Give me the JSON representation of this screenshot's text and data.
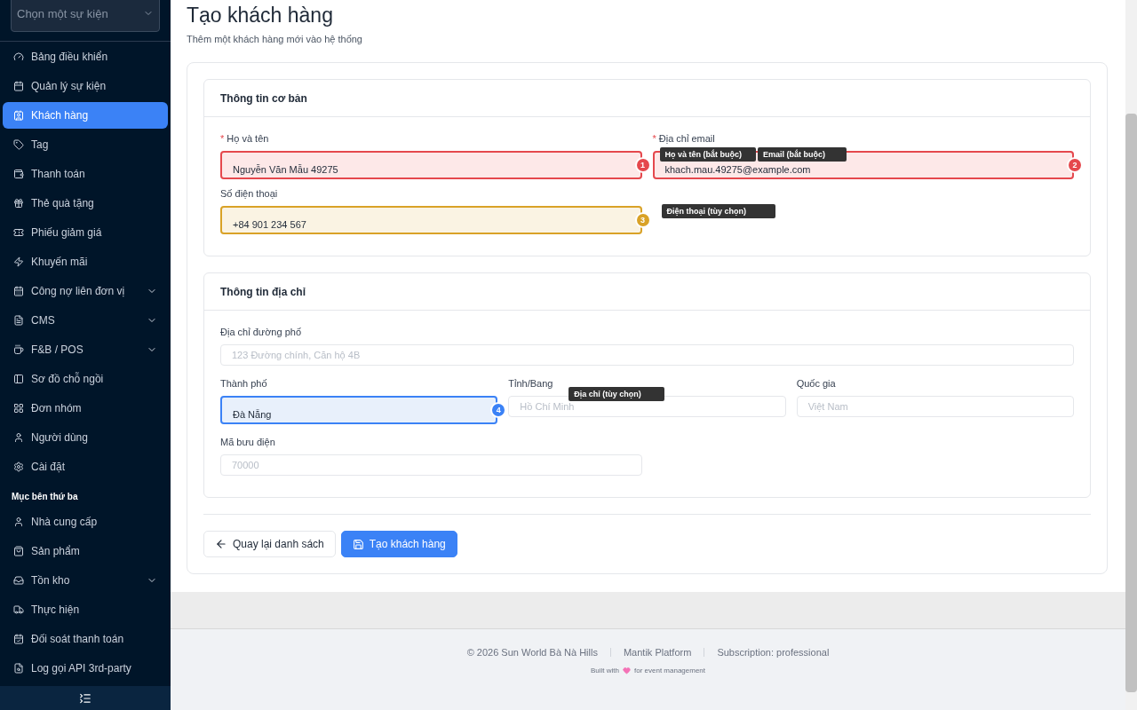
{
  "sidebar": {
    "event_select": {
      "placeholder": "Chọn một sự kiện"
    },
    "items": [
      {
        "label": "Bảng điều khiển",
        "selected": false,
        "expandable": false
      },
      {
        "label": "Quản lý sự kiện",
        "selected": false,
        "expandable": false
      },
      {
        "label": "Khách hàng",
        "selected": true,
        "expandable": false
      },
      {
        "label": "Tag",
        "selected": false,
        "expandable": false
      },
      {
        "label": "Thanh toán",
        "selected": false,
        "expandable": false
      },
      {
        "label": "Thẻ quà tặng",
        "selected": false,
        "expandable": false
      },
      {
        "label": "Phiếu giảm giá",
        "selected": false,
        "expandable": false
      },
      {
        "label": "Khuyến mãi",
        "selected": false,
        "expandable": false
      },
      {
        "label": "Công nợ liên đơn vị",
        "selected": false,
        "expandable": true
      },
      {
        "label": "CMS",
        "selected": false,
        "expandable": true
      },
      {
        "label": "F&B / POS",
        "selected": false,
        "expandable": true
      },
      {
        "label": "Sơ đồ chỗ ngồi",
        "selected": false,
        "expandable": false
      },
      {
        "label": "Đơn nhóm",
        "selected": false,
        "expandable": false
      },
      {
        "label": "Người dùng",
        "selected": false,
        "expandable": false
      },
      {
        "label": "Cài đặt",
        "selected": false,
        "expandable": false
      }
    ],
    "section_title": "Mục bên thứ ba",
    "section_items": [
      {
        "label": "Nhà cung cấp",
        "selected": false,
        "expandable": false
      },
      {
        "label": "Sản phẩm",
        "selected": false,
        "expandable": false
      },
      {
        "label": "Tồn kho",
        "selected": false,
        "expandable": true
      },
      {
        "label": "Thực hiện",
        "selected": false,
        "expandable": false
      },
      {
        "label": "Đối soát thanh toán",
        "selected": false,
        "expandable": false
      },
      {
        "label": "Log gọi API 3rd-party",
        "selected": false,
        "expandable": false
      }
    ]
  },
  "page": {
    "title": "Tạo khách hàng",
    "subtitle": "Thêm một khách hàng mới vào hệ thống"
  },
  "sections": [
    {
      "title": "Thông tin cơ bản",
      "rows": [
        [
          {
            "label": "Họ và tên",
            "mark": "*",
            "value": "Nguyễn Văn Mẫu 49275",
            "annotation": {
              "number": "1",
              "label": "Họ và tên (bắt buộc)",
              "color": "#e5484d"
            }
          },
          {
            "label": "Địa chỉ email",
            "mark": "*",
            "value": "khach.mau.49275@example.com",
            "annotation": {
              "number": "2",
              "label": "Email (bắt buộc)",
              "color": "#e5484d"
            }
          }
        ],
        [
          {
            "label": "Số điện thoại",
            "value": "+84 901 234 567",
            "annotation": {
              "number": "3",
              "label": "Điện thoại (tùy chọn)",
              "color": "#d9a227"
            }
          }
        ]
      ]
    },
    {
      "title": "Thông tin địa chỉ",
      "rows": [
        [
          {
            "label": "Địa chỉ đường phố",
            "placeholder": "123 Đường chính, Căn hộ 4B"
          }
        ],
        [
          {
            "label": "Thành phố",
            "value": "Đà Nẵng",
            "annotation": {
              "number": "4",
              "label": "Địa chỉ (tùy chọn)",
              "color": "#3b82f6"
            }
          },
          {
            "label": "Tỉnh/Bang",
            "placeholder": "Hồ Chí Minh"
          },
          {
            "label": "Quốc gia",
            "placeholder": "Việt Nam"
          }
        ],
        [
          {
            "label": "Mã bưu điện",
            "placeholder": "70000"
          },
          {
            "kind": "spacer"
          }
        ]
      ]
    }
  ],
  "actions": [
    {
      "label": "Quay lại danh sách",
      "kind": "back"
    },
    {
      "label": "Tạo khách hàng",
      "kind": "primary"
    }
  ],
  "footer": {
    "items": [
      "© 2026 Sun World Bà Nà Hills",
      "Mantik Platform",
      "Subscription: professional"
    ],
    "built_before": "Built with",
    "built_after": "for event management"
  }
}
